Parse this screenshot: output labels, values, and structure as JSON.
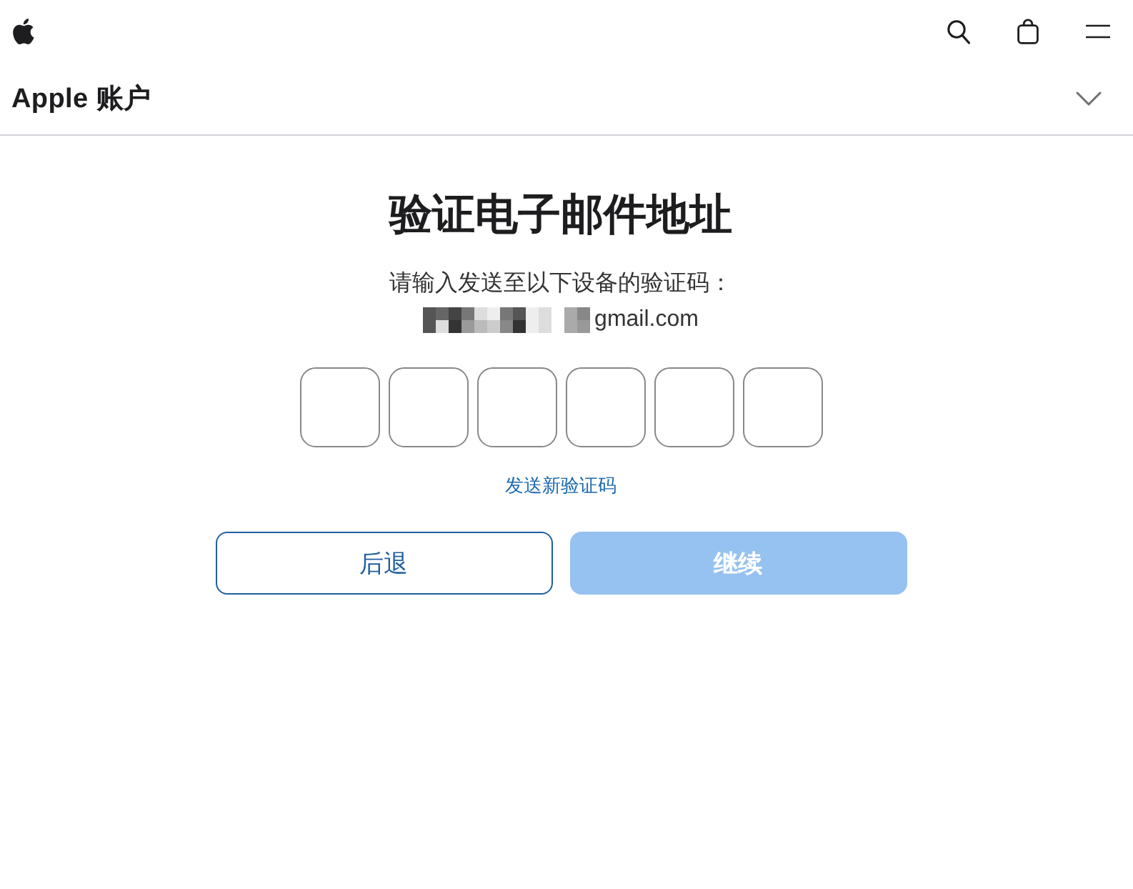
{
  "local_nav": {
    "title": "Apple 账户",
    "expanded": false
  },
  "verification": {
    "title": "验证电子邮件地址",
    "instruction": "请输入发送至以下设备的验证码：",
    "email": {
      "redacted": true,
      "visible_text": "gmail.com"
    },
    "code_fields": [
      {
        "focused": false
      },
      {
        "focused": false
      },
      {
        "focused": false
      },
      {
        "focused": false
      },
      {
        "focused": false
      },
      {
        "focused": false
      }
    ],
    "resend_link": "发送新验证码"
  },
  "buttons": [
    {
      "kind": "secondary",
      "label": "后退",
      "disabled": false
    },
    {
      "kind": "primary",
      "label": "继续",
      "disabled": true
    }
  ]
}
